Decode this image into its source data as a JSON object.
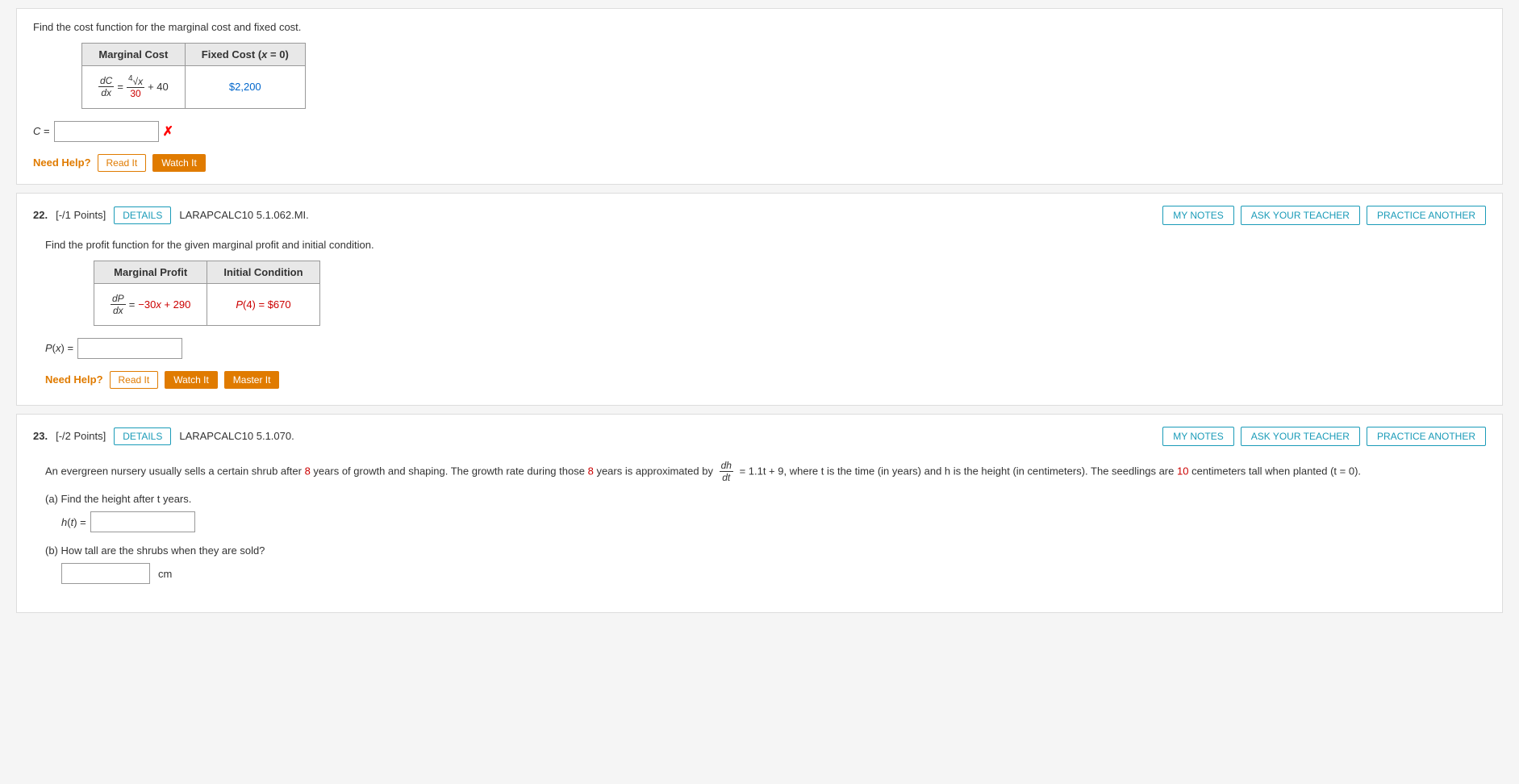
{
  "problem21": {
    "instruction": "Find the cost function for the marginal cost and fixed cost.",
    "table": {
      "headers": [
        "Marginal Cost",
        "Fixed Cost (x = 0)"
      ],
      "rows": [
        {
          "marginal_cost_formula": "dC/dx = ⁴√x/30 + 40",
          "fixed_cost_value": "$2,200"
        }
      ]
    },
    "answer_label": "C =",
    "need_help": "Need Help?",
    "read_it": "Read It",
    "watch_it": "Watch It"
  },
  "problem22": {
    "number": "22.",
    "points": "[-/1 Points]",
    "details_label": "DETAILS",
    "code": "LARAPCALC10 5.1.062.MI.",
    "my_notes": "MY NOTES",
    "ask_teacher": "ASK YOUR TEACHER",
    "practice_another": "PRACTICE ANOTHER",
    "instruction": "Find the profit function for the given marginal profit and initial condition.",
    "table": {
      "headers": [
        "Marginal Profit",
        "Initial Condition"
      ],
      "rows": [
        {
          "marginal_profit": "dP/dx = −30x + 290",
          "initial_condition": "P(4) = $670"
        }
      ]
    },
    "answer_label": "P(x) =",
    "need_help": "Need Help?",
    "read_it": "Read It",
    "watch_it": "Watch It",
    "master_it": "Master It"
  },
  "problem23": {
    "number": "23.",
    "points": "[-/2 Points]",
    "details_label": "DETAILS",
    "code": "LARAPCALC10 5.1.070.",
    "my_notes": "MY NOTES",
    "ask_teacher": "ASK YOUR TEACHER",
    "practice_another": "PRACTICE ANOTHER",
    "instruction_part1": "An evergreen nursery usually sells a certain shrub after",
    "years_val": "8",
    "instruction_part2": "years of growth and shaping. The growth rate during those",
    "years_val2": "8",
    "instruction_part3": "years is approximated by",
    "instruction_part4": "= 1.1t + 9, where t is the time (in years) and h is the height (in centimeters). The seedlings are",
    "height_val": "10",
    "instruction_part5": "centimeters tall when planted (t = 0).",
    "sub_a": "(a)  Find the height after t years.",
    "ht_label": "h(t) =",
    "sub_b": "(b)  How tall are the shrubs when they are sold?",
    "cm_label": "cm"
  }
}
